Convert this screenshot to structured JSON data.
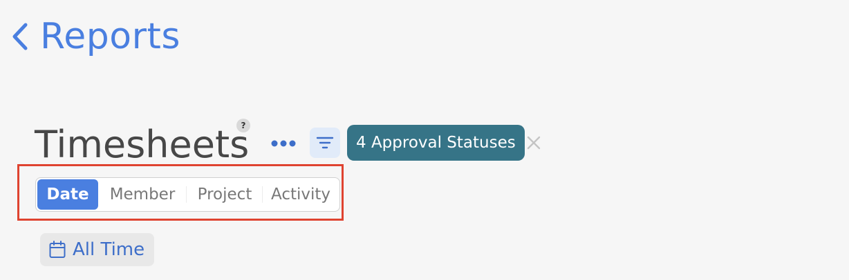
{
  "nav": {
    "back_label": "Reports"
  },
  "header": {
    "title": "Timesheets",
    "help_glyph": "?",
    "more_icon": "more-horizontal-icon",
    "filter_icon": "filter-icon",
    "status_filter_label": "4 Approval Statuses",
    "clear_icon": "close-icon"
  },
  "group_by": {
    "options": [
      "Date",
      "Member",
      "Project",
      "Activity"
    ],
    "selected": "Date"
  },
  "date_range": {
    "icon": "calendar-icon",
    "label": "All Time"
  },
  "colors": {
    "background": "#f6f6f6",
    "primary_blue": "#4a7fe0",
    "status_chip": "#367487",
    "highlight_border": "#df4330",
    "title_text": "#474747"
  }
}
